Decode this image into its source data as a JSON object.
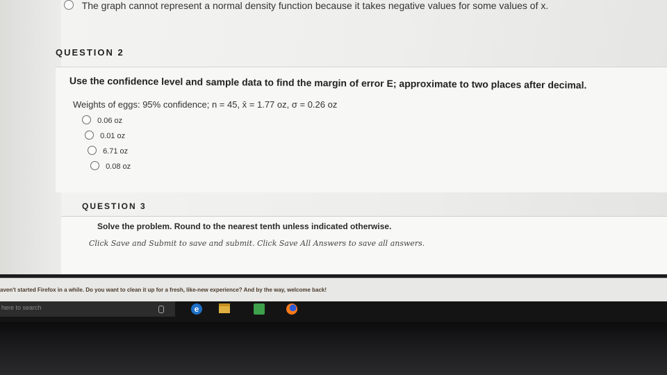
{
  "previous_question": {
    "text": "The graph cannot represent a normal density function because it takes negative values for some values of x."
  },
  "question2": {
    "label": "QUESTION 2",
    "prompt": "Use the confidence level and sample data to find the margin of error E; approximate to two places after decimal.",
    "data_line": "Weights of eggs: 95% confidence;  n = 45,  x̄ = 1.77 oz,  σ = 0.26 oz",
    "options": [
      "0.06 oz",
      "0.01 oz",
      "6.71 oz",
      "0.08 oz"
    ]
  },
  "question3": {
    "label": "QUESTION 3",
    "prompt": "Solve the problem. Round to the nearest tenth unless indicated otherwise."
  },
  "submit_note": "Click Save and Submit to save and submit. Click Save All Answers to save all answers.",
  "notification": {
    "text": "aven't started Firefox in a while. Do you want to clean it up for a fresh, like-new experience? And by the way, welcome back!"
  },
  "taskbar": {
    "search_placeholder": "here to search",
    "icons": [
      "microphone-icon",
      "edge-icon",
      "file-explorer-icon",
      "store-icon",
      "firefox-icon"
    ]
  }
}
